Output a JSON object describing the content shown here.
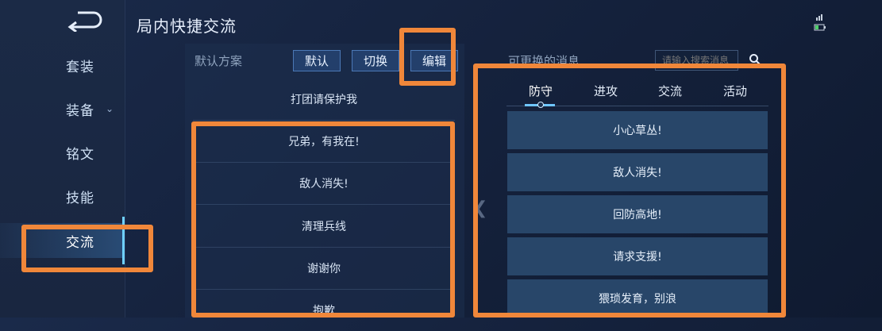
{
  "header": {
    "title": "局内快捷交流"
  },
  "sidebar": {
    "items": [
      {
        "label": "套装"
      },
      {
        "label": "装备"
      },
      {
        "label": "铭文"
      },
      {
        "label": "技能"
      },
      {
        "label": "交流"
      }
    ]
  },
  "default_scheme": {
    "label": "默认方案",
    "buttons": {
      "default": "默认",
      "switch": "切换",
      "edit": "编辑"
    },
    "messages": [
      "打团请保护我",
      "兄弟，有我在!",
      "敌人消失!",
      "清理兵线",
      "谢谢你",
      "抱歉"
    ]
  },
  "replaceable": {
    "title": "可更换的消息",
    "search": {
      "placeholder": "请输入搜索消息"
    },
    "tabs": [
      "防守",
      "进攻",
      "交流",
      "活动"
    ],
    "active_tab": "防守",
    "messages": [
      "小心草丛!",
      "敌人消失!",
      "回防高地!",
      "请求支援!",
      "猥琐发育，别浪"
    ]
  },
  "colors": {
    "highlight": "#f0873a",
    "accent": "#6fc6ff",
    "button_bg": "#233f6b",
    "row_bg": "#284669"
  },
  "icons": [
    "back-arrow-icon",
    "chevron-down-icon",
    "search-icon",
    "signal-icon",
    "battery-icon",
    "chevron-left-icon"
  ]
}
